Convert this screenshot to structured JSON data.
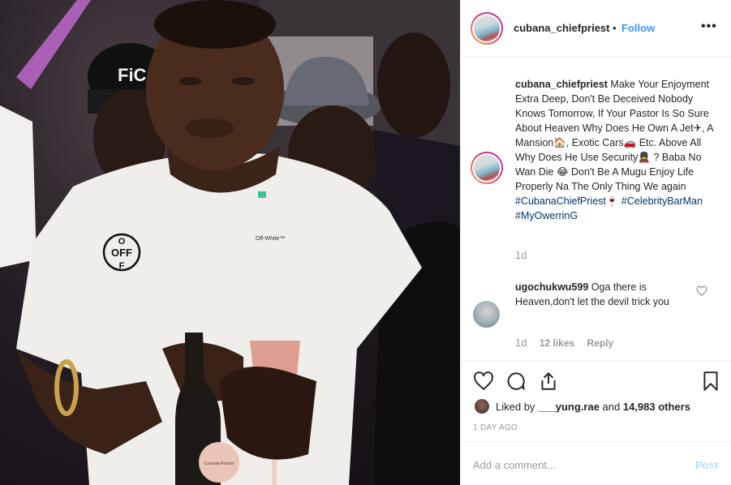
{
  "header": {
    "username": "cubana_chiefpriest",
    "separator": "•",
    "follow_label": "Follow",
    "more_icon": "more-horizontal-icon"
  },
  "caption": {
    "username": "cubana_chiefpriest",
    "text": " Make Your Enjoyment Extra Deep, Don't Be Deceived Nobody Knows Tomorrow, If Your Pastor Is So Sure About Heaven Why Does He Own A Jet✈, A Mansion🏠, Exotic Cars🚗 Etc. Above All Why Does He Use Security💂‍♀ ? Baba No Wan Die 😂 Don't Be A Mugu Enjoy Life Properly Na The Only Thing We again ",
    "hashtag1": "#CubanaChiefPriest🍷",
    "hashtag2": "#CelebrityBarMan",
    "hashtag3": "#MyOwerrinG",
    "time": "1d"
  },
  "comment": {
    "username": "ugochukwu599",
    "text": " Oga there is Heaven,don't let the devil trick you",
    "time": "1d",
    "likes": "12 likes",
    "reply": "Reply"
  },
  "likes": {
    "prefix": "Liked by ",
    "user": "___yung.rae",
    "middle": " and ",
    "others": "14,983 others"
  },
  "timestamp": "1 DAY AGO",
  "add_comment": {
    "placeholder": "Add a comment...",
    "post_label": "Post"
  },
  "photo": {
    "shirt_patch_text": "OFF",
    "shirt_patch_letters": [
      "O",
      "OFF",
      "F"
    ],
    "shirt_brand_text": "Off-White™",
    "cap_text": "FiC",
    "bottle_label": "Laurent-Perrier"
  },
  "colors": {
    "link_blue": "#3897f0",
    "hashtag_navy": "#003569",
    "muted_gray": "#999999",
    "post_disabled": "#b2dffc"
  }
}
